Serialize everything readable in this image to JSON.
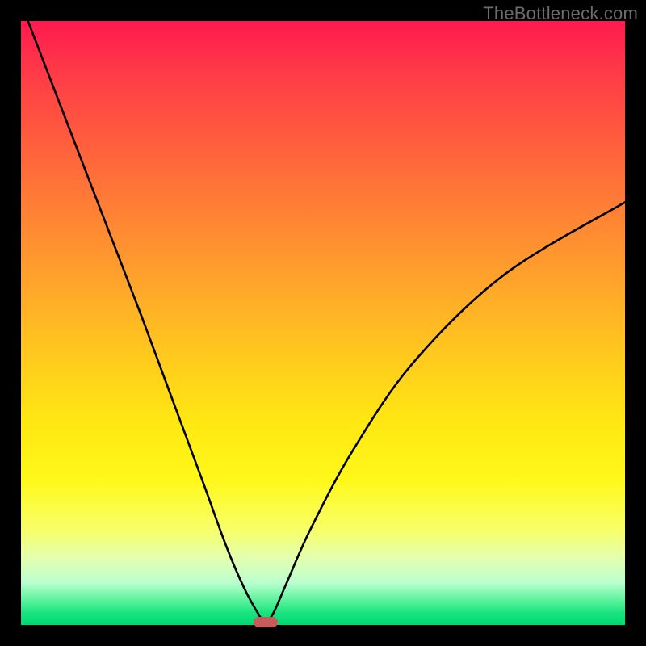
{
  "watermark": "TheBottleneck.com",
  "colors": {
    "frame": "#000000",
    "curve": "#000000",
    "marker": "#c85a5a",
    "gradient_top": "#ff1a4f",
    "gradient_bottom": "#00d873"
  },
  "chart_data": {
    "type": "line",
    "title": "",
    "xlabel": "",
    "ylabel": "",
    "xlim": [
      0,
      100
    ],
    "ylim": [
      0,
      100
    ],
    "series": [
      {
        "name": "bottleneck-curve",
        "x": [
          0,
          5,
          10,
          15,
          20,
          25,
          30,
          34,
          37,
          39.5,
          40.5,
          41,
          42,
          44,
          48,
          55,
          65,
          80,
          100
        ],
        "y": [
          103,
          90,
          77,
          64,
          51,
          37.5,
          24,
          13,
          6,
          1.5,
          0.4,
          0.8,
          2.4,
          7,
          16,
          29,
          43.5,
          58,
          70
        ]
      }
    ],
    "marker": {
      "x": 40.5,
      "y": 0.4
    },
    "grid": false,
    "legend": false
  }
}
